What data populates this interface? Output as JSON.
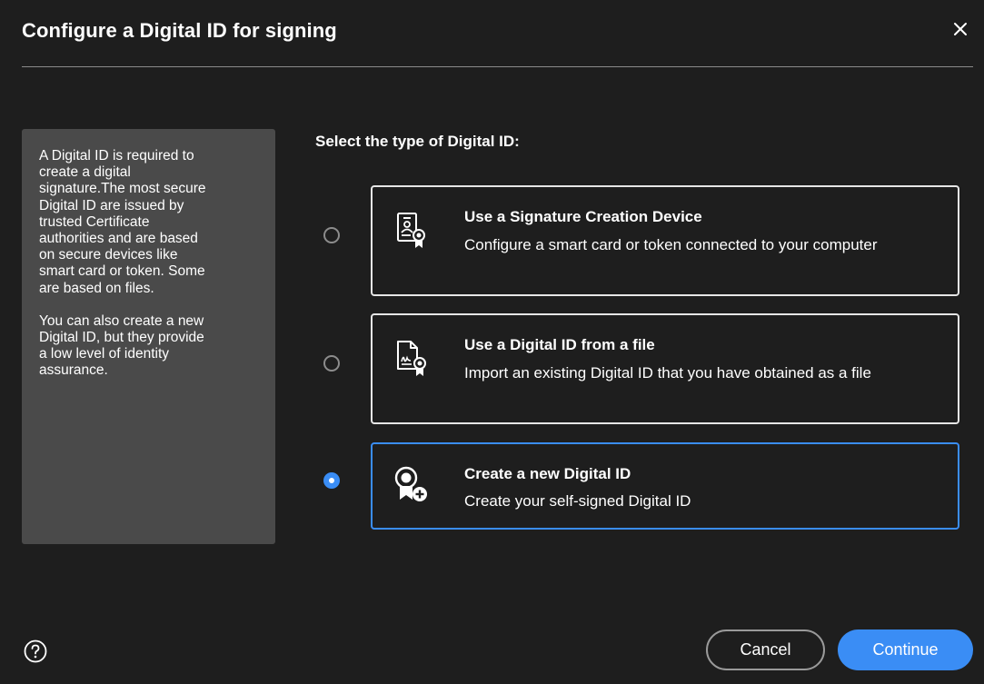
{
  "dialog": {
    "title": "Configure a Digital ID for signing",
    "close_icon": "close-icon"
  },
  "info": {
    "paragraph1": "A Digital ID is required to\ncreate a digital\nsignature.The most secure\nDigital ID are issued by\ntrusted Certificate\nauthorities and are based\non secure devices like\nsmart card or token. Some\nare based on files.",
    "paragraph2": "You can also create a new\nDigital ID, but they provide\na low level of identity\nassurance."
  },
  "selection": {
    "heading": "Select the type of Digital ID:",
    "options": [
      {
        "title": "Use a Signature Creation Device",
        "description": "Configure a smart card or token connected to your computer",
        "icon": "certificate-device-icon",
        "selected": false
      },
      {
        "title": "Use a Digital ID from a file",
        "description": "Import an existing Digital ID that you have obtained as a file",
        "icon": "certificate-file-icon",
        "selected": false
      },
      {
        "title": "Create a new Digital ID",
        "description": "Create your self-signed Digital ID",
        "icon": "new-digital-id-icon",
        "selected": true
      }
    ]
  },
  "footer": {
    "help_icon": "help-icon",
    "cancel_label": "Cancel",
    "continue_label": "Continue"
  },
  "colors": {
    "background": "#1e1e1e",
    "panel": "#4a4a4a",
    "accent": "#3a8df5",
    "card_border": "#e6e6e6"
  }
}
